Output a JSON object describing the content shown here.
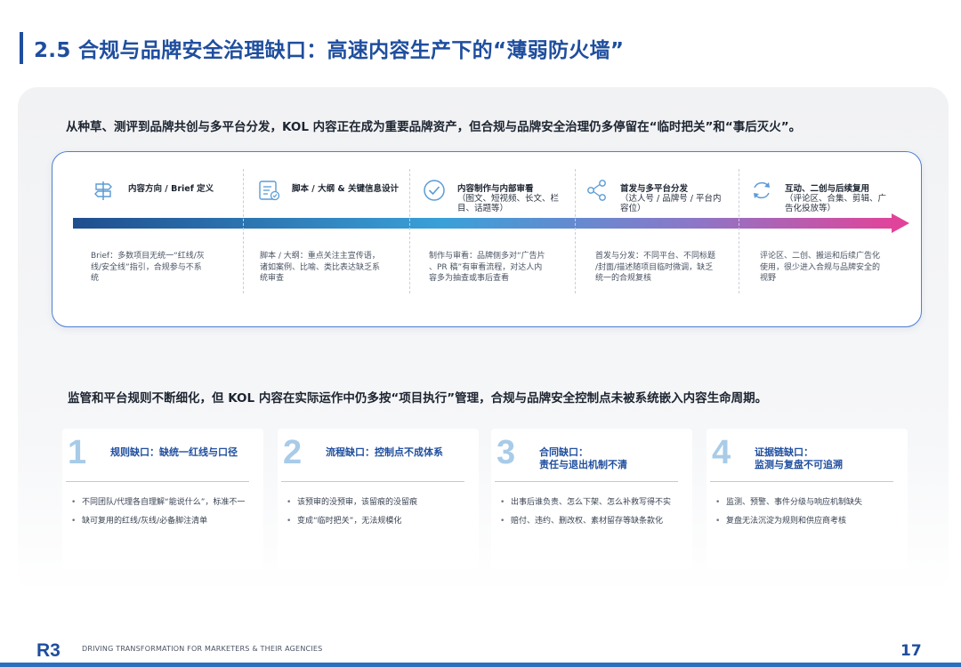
{
  "title": "2.5 合规与品牌安全治理缺口：高速内容生产下的“薄弱防火墙”",
  "intro": "从种草、测评到品牌共创与多平台分发，KOL 内容正在成为重要品牌资产，但合规与品牌安全治理仍多停留在“临时把关”和“事后灭火”。",
  "stages": [
    {
      "icon": "signpost-icon",
      "title": "内容方向 / Brief 定义",
      "sub": "",
      "desc": [
        "Brief：多数项目无统一“红线/灰",
        "线/安全线”指引，合规参与不系",
        "统"
      ]
    },
    {
      "icon": "checklist-icon",
      "title": "脚本 / 大纲 & 关键信息设计",
      "sub": "",
      "desc": [
        "脚本 / 大纲：重点关注主宣传语，",
        "诸如案例、比喻、类比表达缺乏系",
        "统审查"
      ]
    },
    {
      "icon": "check-circle-icon",
      "title": "内容制作与内部审看",
      "sub": [
        "（图文、短视频、长文、栏",
        "目、话题等）"
      ],
      "desc": [
        "制作与审看：品牌侧多对“广告片",
        "、PR 稿”有审看流程，对达人内",
        "容多为抽查或事后查看"
      ]
    },
    {
      "icon": "share-icon",
      "title": "首发与多平台分发",
      "sub": [
        "（达人号 / 品牌号 / 平台内",
        "容位）"
      ],
      "desc": [
        "首发与分发：不同平台、不同标题",
        "/封面/描述随项目临时微调，缺乏",
        "统一的合规复核"
      ]
    },
    {
      "icon": "refresh-icon",
      "title": "互动、二创与后续复用",
      "sub": [
        "（评论区、合集、剪辑、广",
        "告化投放等）"
      ],
      "desc": [
        "评论区、二创、搬运和后续广告化",
        "使用，很少进入合规与品牌安全的",
        "视野"
      ]
    }
  ],
  "mid": "监管和平台规则不断细化，但 KOL 内容在实际运作中仍多按“项目执行”管理，合规与品牌安全控制点未被系统嵌入内容生命周期。",
  "gaps": [
    {
      "num": "1",
      "title": [
        "规则缺口：缺统一红线与口径"
      ],
      "items": [
        "不同团队/代理各自理解“能说什么”，标准不一",
        "缺可复用的红线/灰线/必备脚注清单"
      ]
    },
    {
      "num": "2",
      "title": [
        "流程缺口：控制点不成体系"
      ],
      "items": [
        "该预审的没预审，该留痕的没留痕",
        "变成“临时把关”，无法规模化"
      ]
    },
    {
      "num": "3",
      "title": [
        "合同缺口：",
        "责任与退出机制不清"
      ],
      "items": [
        "出事后谁负责、怎么下架、怎么补救写得不实",
        "赔付、违约、删改权、素材留存等缺条款化"
      ]
    },
    {
      "num": "4",
      "title": [
        "证据链缺口：",
        "监测与复盘不可追溯"
      ],
      "items": [
        "监测、预警、事件分级与响应机制缺失",
        "复盘无法沉淀为规则和供应商考核"
      ]
    }
  ],
  "footer": {
    "logo": "R3",
    "tagline": "DRIVING TRANSFORMATION FOR MARKETERS & THEIR AGENCIES",
    "page": "17"
  },
  "colors": {
    "brand": "#1f4e9e",
    "arrow_start": "#1f4e8e",
    "arrow_mid": "#3aa0d8",
    "arrow_end": "#e0449a",
    "number": "#a8cbe8"
  }
}
